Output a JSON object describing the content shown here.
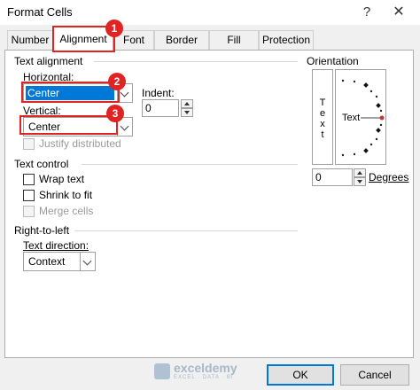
{
  "window": {
    "title": "Format Cells",
    "help_glyph": "?",
    "close_glyph": "✕"
  },
  "tabs": [
    {
      "label": "Number",
      "active": false
    },
    {
      "label": "Alignment",
      "active": true
    },
    {
      "label": "Font",
      "active": false
    },
    {
      "label": "Border",
      "active": false
    },
    {
      "label": "Fill",
      "active": false
    },
    {
      "label": "Protection",
      "active": false
    }
  ],
  "text_alignment": {
    "group_title": "Text alignment",
    "horizontal_label": "Horizontal:",
    "horizontal_value": "Center",
    "indent_label": "Indent:",
    "indent_value": "0",
    "vertical_label": "Vertical:",
    "vertical_value": "Center",
    "justify_distributed_label": "Justify distributed",
    "justify_distributed_checked": false,
    "justify_distributed_enabled": false
  },
  "text_control": {
    "group_title": "Text control",
    "wrap_text_label": "Wrap text",
    "wrap_text_checked": false,
    "shrink_to_fit_label": "Shrink to fit",
    "shrink_to_fit_checked": false,
    "merge_cells_label": "Merge cells",
    "merge_cells_enabled": false
  },
  "right_to_left": {
    "group_title": "Right-to-left",
    "text_direction_label": "Text direction:",
    "text_direction_value": "Context"
  },
  "orientation": {
    "group_title": "Orientation",
    "vertical_text_letters": [
      "T",
      "e",
      "x",
      "t"
    ],
    "dial_text": "Text",
    "degrees_value": "0",
    "degrees_label": "Degrees"
  },
  "callouts": {
    "one": "1",
    "two": "2",
    "three": "3",
    "color": "#e02424"
  },
  "footer": {
    "ok_label": "OK",
    "cancel_label": "Cancel"
  },
  "watermark": {
    "name": "exceldemy",
    "tagline": "EXCEL · DATA · BI"
  },
  "colors": {
    "accent": "#0078d7",
    "dialog_bg": "#f0f0f0"
  }
}
